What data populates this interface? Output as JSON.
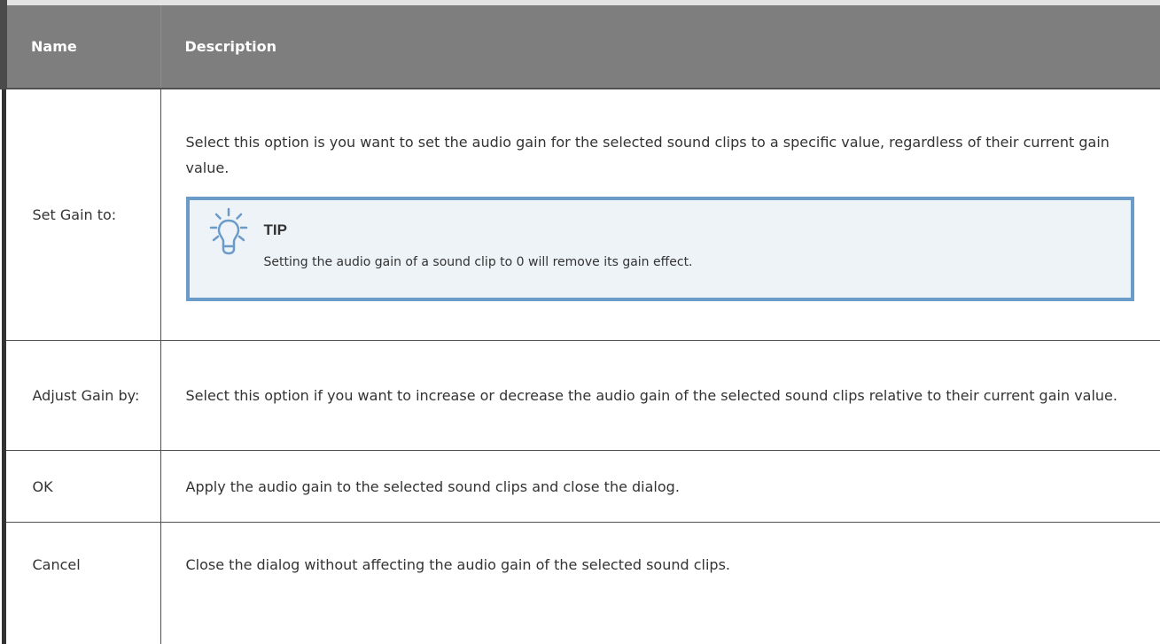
{
  "table": {
    "headers": {
      "name": "Name",
      "description": "Description"
    },
    "rows": [
      {
        "name": "Set Gain to:",
        "description": "Select this option is you want to set the audio gain for the selected sound clips to a specific value, regardless of their current gain value.",
        "tip": {
          "label": "TIP",
          "text": "Setting the audio gain of a sound clip to 0 will remove its gain effect.",
          "icon": "lightbulb-icon"
        }
      },
      {
        "name": "Adjust Gain by:",
        "description": "Select this option if you want to increase or decrease the audio gain of the selected sound clips relative to their current gain value."
      },
      {
        "name": "OK",
        "description": "Apply the audio gain to the selected sound clips and close the dialog."
      },
      {
        "name": "Cancel",
        "description": "Close the dialog without affecting the audio gain of the selected sound clips."
      }
    ]
  },
  "colors": {
    "header_bg": "#7e7e7e",
    "header_text": "#ffffff",
    "tip_border": "#6b9bc9",
    "tip_bg": "#eef3f8",
    "body_text": "#333333"
  }
}
